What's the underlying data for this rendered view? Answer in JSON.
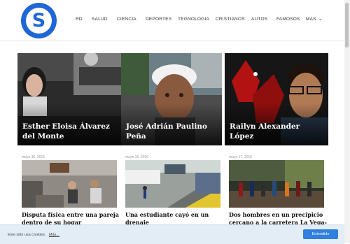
{
  "logo": {
    "letter": "S"
  },
  "nav": {
    "items": [
      "RD",
      "SALUD",
      "CIENCIA",
      "DEPORTES",
      "TEGNOLOGIA",
      "CRISTIANOS",
      "AUTOS",
      "FAMOSOS",
      "MAS"
    ]
  },
  "featured": [
    {
      "title": "Esther Eloisa Álvarez del Monte"
    },
    {
      "title": "José Adrián Paulino Peña"
    },
    {
      "title": "Railyn Alexander López"
    }
  ],
  "articles": [
    {
      "date": "mayo 30, 2016",
      "title": "Disputa física entre una pareja dentro de su hogar"
    },
    {
      "date": "mayo 15, 2016",
      "title": "Una estudiante cayó en un drenaje"
    },
    {
      "date": "mayo 17, 2016",
      "title": "Dos hombres en un precipicio cercano a la carretera La Vega-"
    }
  ],
  "cookie": {
    "text": "Este sitio usa cookies.",
    "link": "Más...",
    "button": "Entendido"
  },
  "colors": {
    "brand": "#1f66d6",
    "cookie_bg": "#e3edf6",
    "cookie_button": "#2f80e0"
  }
}
